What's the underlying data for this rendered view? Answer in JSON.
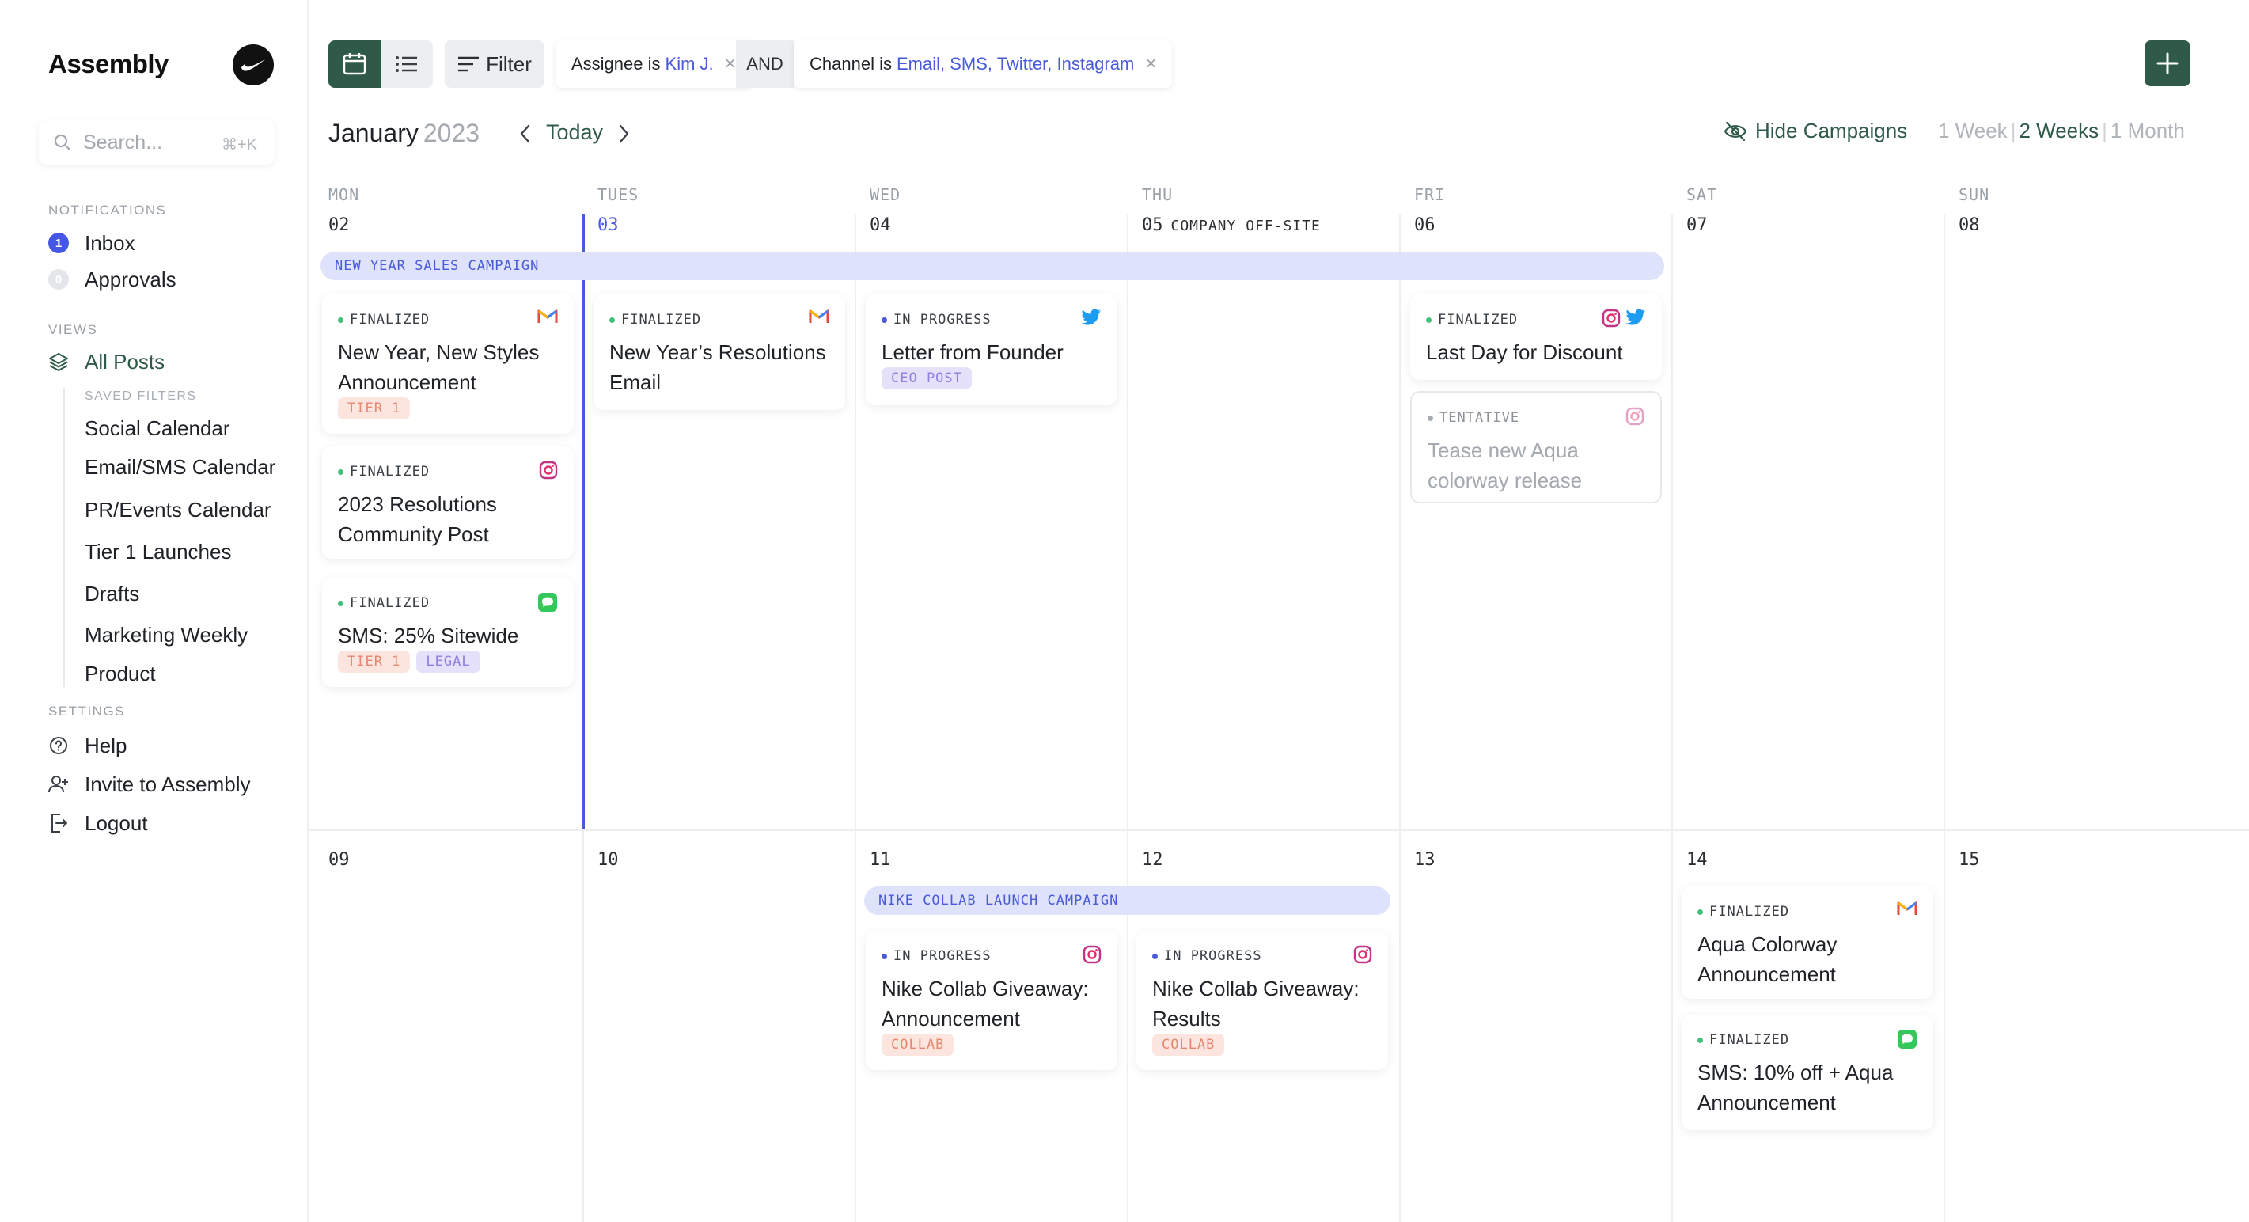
{
  "app": {
    "name": "Assembly"
  },
  "search": {
    "placeholder": "Search...",
    "shortcut": "⌘+K"
  },
  "sidebar": {
    "notifications_label": "NOTIFICATIONS",
    "inbox": {
      "label": "Inbox",
      "count": "1"
    },
    "approvals": {
      "label": "Approvals",
      "count": "0"
    },
    "views_label": "VIEWS",
    "all_posts": "All Posts",
    "saved_filters_label": "SAVED FILTERS",
    "saved_filters": [
      "Social Calendar",
      "Email/SMS Calendar",
      "PR/Events Calendar",
      "Tier 1 Launches",
      "Drafts",
      "Marketing Weekly",
      "Product"
    ],
    "settings_label": "SETTINGS",
    "help": "Help",
    "invite": "Invite to Assembly",
    "logout": "Logout"
  },
  "toolbar": {
    "filter_label": "Filter",
    "chip1": {
      "key": "Assignee is",
      "value": "Kim J."
    },
    "and_label": "AND",
    "chip2": {
      "key": "Channel is",
      "value": "Email, SMS, Twitter, Instagram"
    },
    "close_glyph": "×"
  },
  "header": {
    "month": "January",
    "year": "2023",
    "today_label": "Today",
    "hide_campaigns": "Hide Campaigns",
    "ranges": [
      "1 Week",
      "2 Weeks",
      "1 Month"
    ],
    "active_range": "2 Weeks"
  },
  "calendar": {
    "weekdays": [
      "MON",
      "TUES",
      "WED",
      "THU",
      "FRI",
      "SAT",
      "SUN"
    ],
    "week1_days": [
      "02",
      "03",
      "04",
      "05",
      "06",
      "07",
      "08"
    ],
    "week2_days": [
      "09",
      "10",
      "11",
      "12",
      "13",
      "14",
      "15"
    ],
    "day05_note": "COMPANY OFF-SITE",
    "campaigns": [
      "NEW YEAR SALES CAMPAIGN",
      "NIKE COLLAB LAUNCH CAMPAIGN"
    ],
    "status_labels": {
      "finalized": "FINALIZED",
      "in_progress": "IN PROGRESS",
      "tentative": "TENTATIVE"
    },
    "posts": [
      {
        "status": "FINALIZED",
        "title": "New Year, New Styles Announcement",
        "channels": [
          "gmail"
        ],
        "tags": [
          "TIER 1"
        ]
      },
      {
        "status": "FINALIZED",
        "title": "2023 Resolutions Community Post",
        "channels": [
          "instagram"
        ],
        "tags": []
      },
      {
        "status": "FINALIZED",
        "title": "SMS: 25% Sitewide",
        "channels": [
          "sms"
        ],
        "tags": [
          "TIER 1",
          "LEGAL"
        ]
      },
      {
        "status": "FINALIZED",
        "title": "New Year’s Resolutions Email",
        "channels": [
          "gmail"
        ],
        "tags": []
      },
      {
        "status": "IN PROGRESS",
        "title": "Letter from Founder",
        "channels": [
          "twitter"
        ],
        "tags": [
          "CEO POST"
        ]
      },
      {
        "status": "FINALIZED",
        "title": "Last Day for Discount",
        "channels": [
          "instagram",
          "twitter"
        ],
        "tags": []
      },
      {
        "status": "TENTATIVE",
        "title": "Tease new Aqua colorway release",
        "channels": [
          "instagram"
        ],
        "tags": []
      },
      {
        "status": "IN PROGRESS",
        "title": "Nike Collab Giveaway: Announcement",
        "channels": [
          "instagram"
        ],
        "tags": [
          "COLLAB"
        ]
      },
      {
        "status": "IN PROGRESS",
        "title": "Nike Collab Giveaway: Results",
        "channels": [
          "instagram"
        ],
        "tags": [
          "COLLAB"
        ]
      },
      {
        "status": "FINALIZED",
        "title": "Aqua Colorway Announcement",
        "channels": [
          "gmail"
        ],
        "tags": []
      },
      {
        "status": "FINALIZED",
        "title": "SMS: 10% off + Aqua Announcement",
        "channels": [
          "sms"
        ],
        "tags": []
      }
    ]
  },
  "colors": {
    "accent_green": "#2f5a48",
    "accent_blue": "#4a5bd9",
    "campaign_bg": "#dfe2fb",
    "finalized_dot": "#45c07a",
    "tag_peach": "#fde5df",
    "tag_lavender": "#e6e1fb"
  }
}
